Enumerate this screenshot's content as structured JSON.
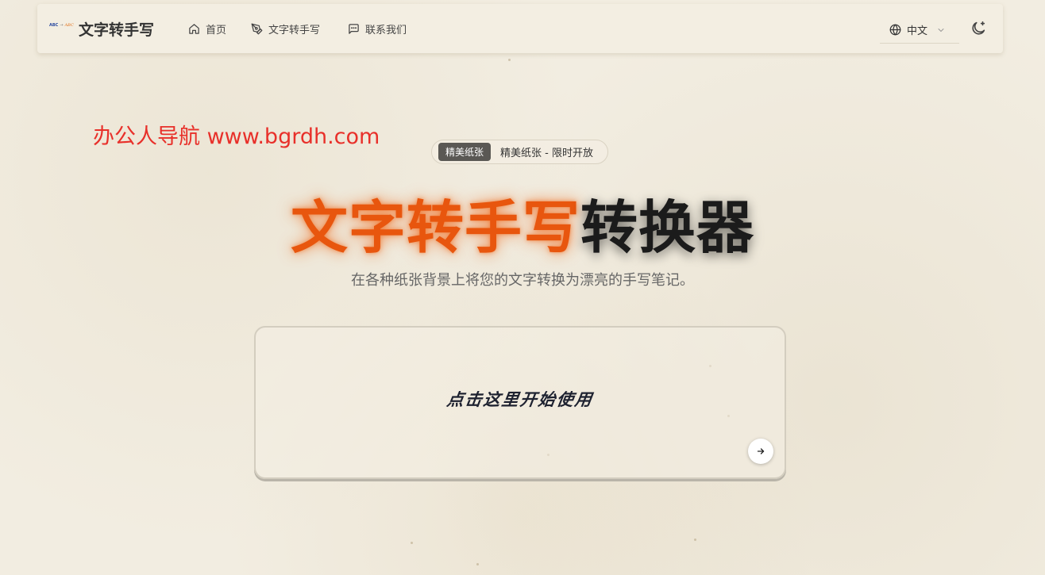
{
  "nav": {
    "logo_left": "ABC",
    "logo_arrow": "→",
    "logo_right": "ABC",
    "brand": "文字转手写",
    "items": [
      {
        "label": "首页",
        "icon": "home-icon"
      },
      {
        "label": "文字转手写",
        "icon": "pen-icon"
      },
      {
        "label": "联系我们",
        "icon": "message-icon"
      }
    ],
    "language": "中文",
    "theme_icon": "moon-icon"
  },
  "watermark": "办公人导航 www.bgrdh.com",
  "badge": {
    "pill": "精美纸张",
    "text": "精美纸张 - 限时开放"
  },
  "hero": {
    "title_highlight": "文字转手写",
    "title_rest": "转换器",
    "subtitle": "在各种纸张背景上将您的文字转换为漂亮的手写笔记。"
  },
  "card": {
    "prompt": "点击这里开始使用",
    "arrow_icon": "arrow-right-icon"
  },
  "colors": {
    "accent": "#e8560e",
    "background": "#f2ede1",
    "watermark": "#e8302a"
  }
}
